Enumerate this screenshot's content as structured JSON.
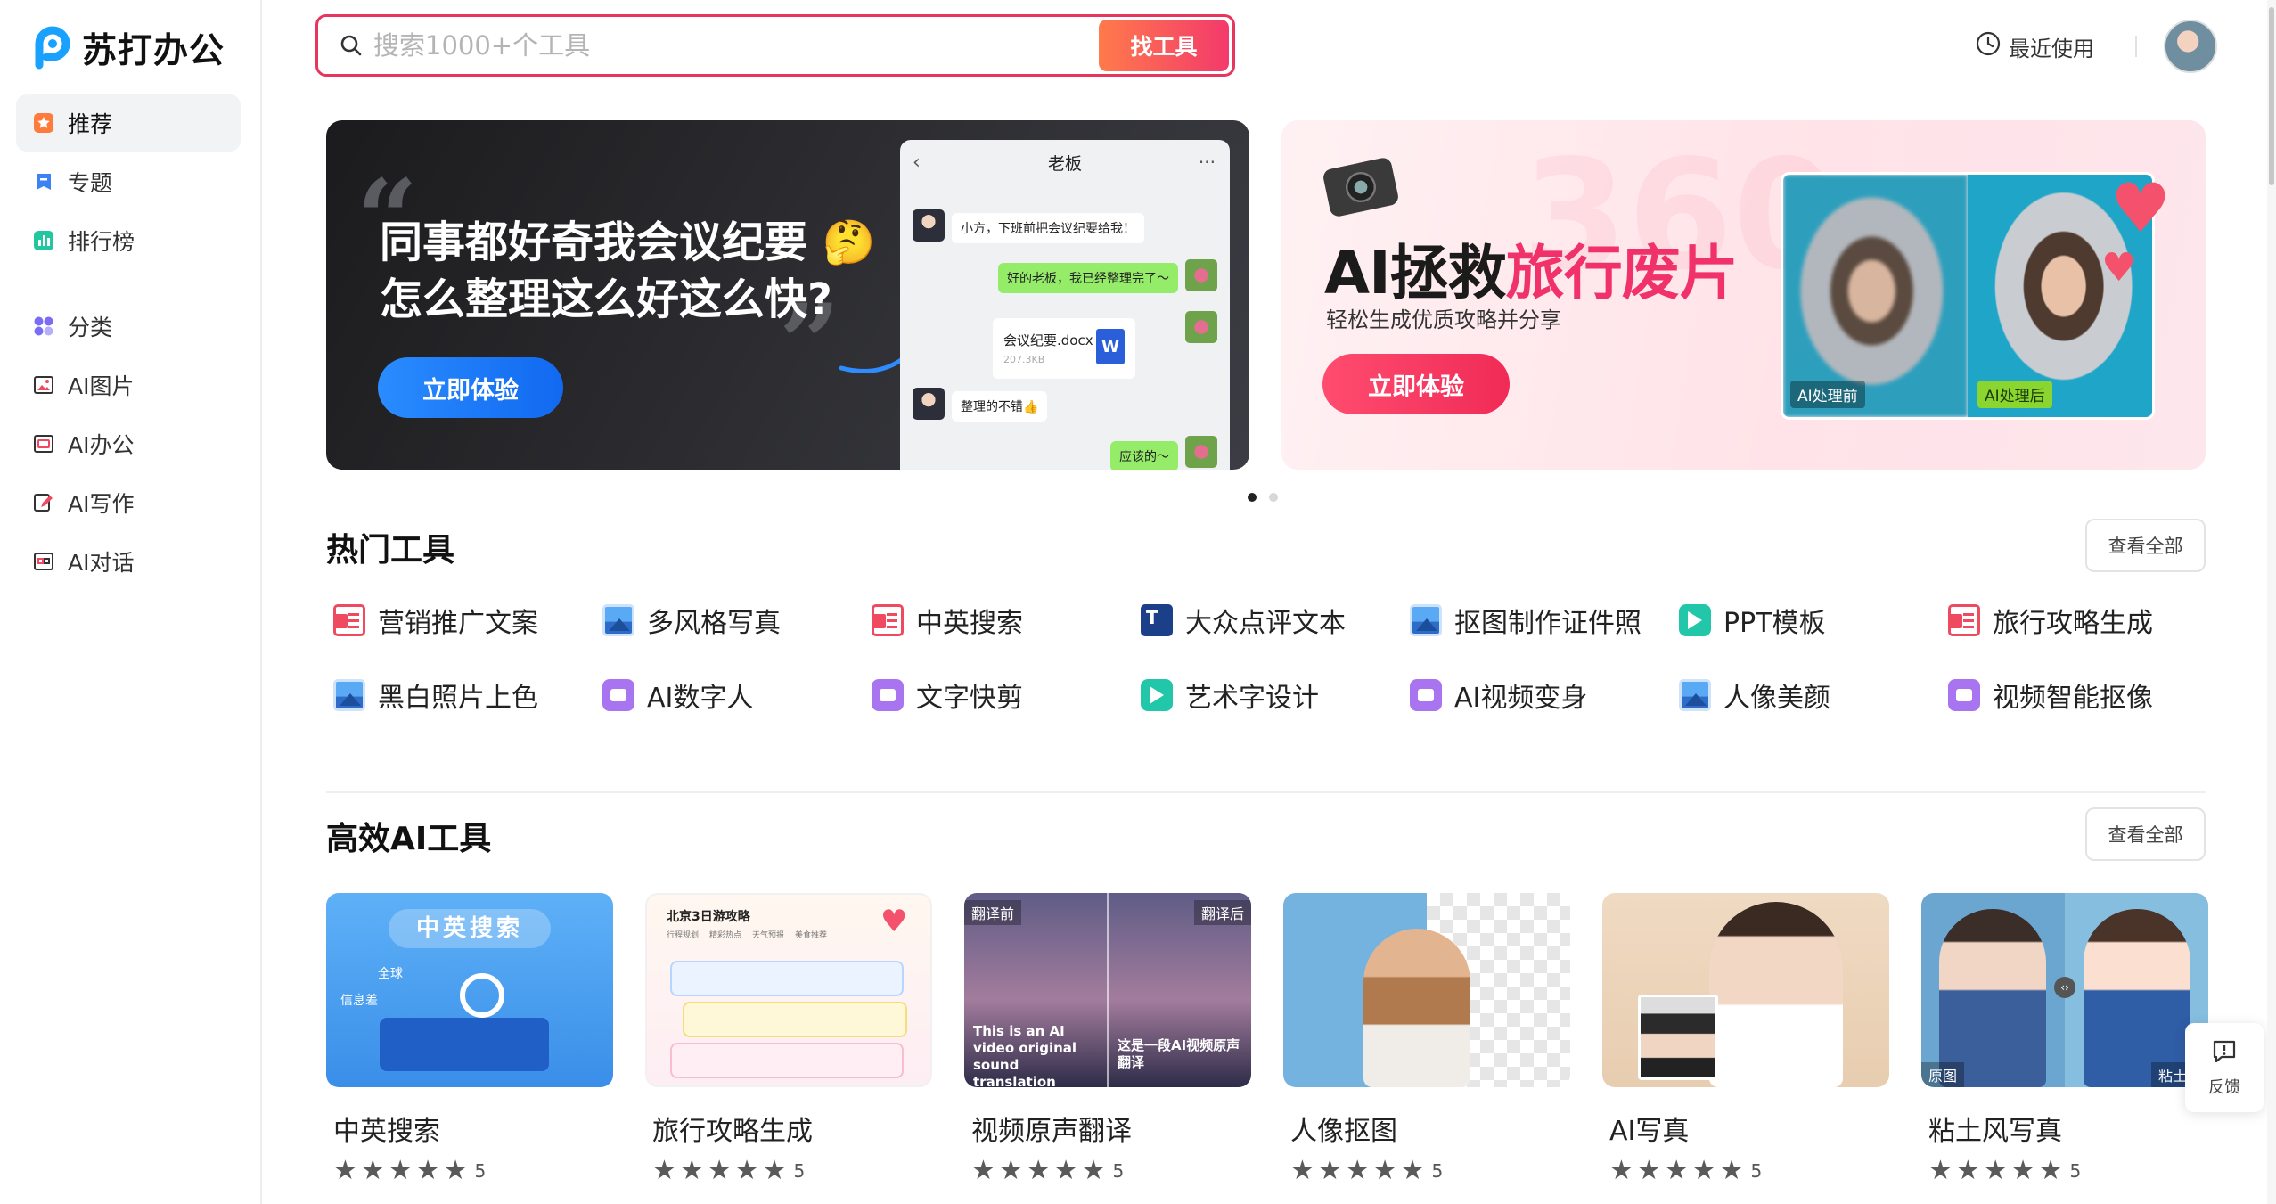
{
  "app": {
    "name": "苏打办公",
    "brand_color": "#19a1ff",
    "accent_color": "#f0316a"
  },
  "sidebar": {
    "items": [
      {
        "label": "推荐",
        "icon": "star-square-icon",
        "active": true
      },
      {
        "label": "专题",
        "icon": "bookmark-icon"
      },
      {
        "label": "排行榜",
        "icon": "bar-chart-icon"
      },
      {
        "label": "分类",
        "icon": "grid-dots-icon"
      },
      {
        "label": "AI图片",
        "icon": "image-icon"
      },
      {
        "label": "AI办公",
        "icon": "office-icon"
      },
      {
        "label": "AI写作",
        "icon": "pen-icon"
      },
      {
        "label": "AI对话",
        "icon": "chat-icon"
      }
    ]
  },
  "search": {
    "placeholder": "搜索1000+个工具",
    "value": "",
    "button": "找工具"
  },
  "header": {
    "recent": "最近使用"
  },
  "banners": [
    {
      "title_line1": "同事都好奇我会议纪要",
      "title_emoji": "🤔",
      "title_line2": "怎么整理这么好这么快?",
      "cta": "立即体验",
      "chat": {
        "contact": "老板",
        "messages": [
          "小方，下班前把会议纪要给我！",
          "好的老板，我已经整理完了～",
          "整理的不错👍",
          "应该的～"
        ],
        "file_name": "会议纪要.docx",
        "file_size": "207.3KB",
        "file_icon": "W"
      }
    },
    {
      "title_plain": "AI拯救",
      "title_highlight": "旅行废片",
      "subtitle": "轻松生成优质攻略并分享",
      "cta": "立即体验",
      "watermark": "360",
      "label_before": "AI处理前",
      "label_after": "AI处理后"
    }
  ],
  "carousel": {
    "total": 2,
    "active": 1
  },
  "hot_tools": {
    "title": "热门工具",
    "view_all": "查看全部",
    "items": [
      {
        "label": "营销推广文案",
        "icon": "pdf"
      },
      {
        "label": "多风格写真",
        "icon": "img"
      },
      {
        "label": "中英搜索",
        "icon": "pdf"
      },
      {
        "label": "大众点评文本",
        "icon": "doc"
      },
      {
        "label": "抠图制作证件照",
        "icon": "img"
      },
      {
        "label": "PPT模板",
        "icon": "ppt"
      },
      {
        "label": "旅行攻略生成",
        "icon": "pdf"
      },
      {
        "label": "黑白照片上色",
        "icon": "img"
      },
      {
        "label": "AI数字人",
        "icon": "vid"
      },
      {
        "label": "文字快剪",
        "icon": "vid"
      },
      {
        "label": "艺术字设计",
        "icon": "ppt"
      },
      {
        "label": "AI视频变身",
        "icon": "vid"
      },
      {
        "label": "人像美颜",
        "icon": "img"
      },
      {
        "label": "视频智能抠像",
        "icon": "vid"
      }
    ]
  },
  "ai_tools": {
    "title": "高效AI工具",
    "view_all": "查看全部",
    "cards": [
      {
        "title": "中英搜索",
        "rating": "5",
        "thumb_text": "中英搜索",
        "thumb_labels": [
          "全球",
          "信息差"
        ]
      },
      {
        "title": "旅行攻略生成",
        "rating": "5",
        "thumb_text": "北京3日游攻略",
        "thumb_labels": [
          "行程规划",
          "精彩热点",
          "天气预报",
          "美食推荐"
        ]
      },
      {
        "title": "视频原声翻译",
        "rating": "5",
        "thumb_labels": [
          "翻译前",
          "翻译后"
        ],
        "thumb_caption_left": "This is an AI video original sound translation",
        "thumb_caption_right": "这是一段AI视频原声翻译"
      },
      {
        "title": "人像抠图",
        "rating": "5"
      },
      {
        "title": "AI写真",
        "rating": "5"
      },
      {
        "title": "粘土风写真",
        "rating": "5",
        "thumb_labels": [
          "原图",
          "粘土风"
        ]
      }
    ]
  },
  "feedback": {
    "label": "反馈"
  }
}
